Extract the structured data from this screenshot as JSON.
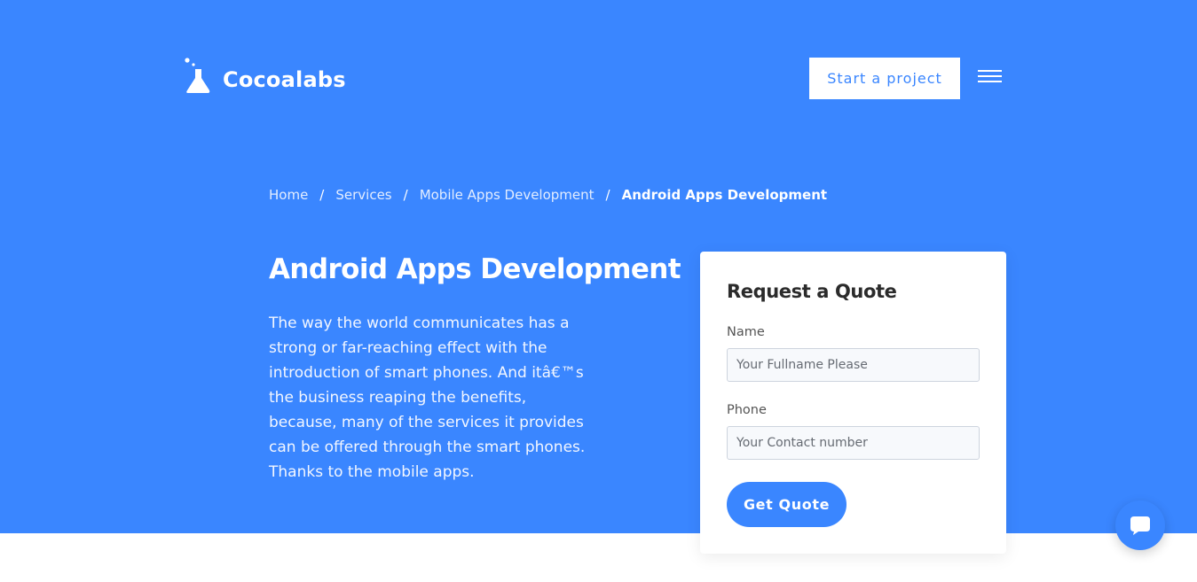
{
  "colors": {
    "brand": "#3a86ff",
    "card": "#ffffff",
    "title_dark": "#2b2b2b"
  },
  "header": {
    "logo_icon": "flask-icon",
    "logo_text": "Cocoalabs",
    "cta_label": "Start a project",
    "menu_icon": "hamburger-icon"
  },
  "breadcrumb": {
    "items": [
      "Home",
      "Services",
      "Mobile Apps Development"
    ],
    "separator": "/",
    "current": "Android Apps Development"
  },
  "hero": {
    "title": "Android Apps Development",
    "intro": "The way the world communicates has a strong or far-reaching effect with the introduction of smart phones. And itâ€™s the business reaping the benefits, because, many of the services it provides can be offered through the smart phones. Thanks to the mobile apps."
  },
  "quote_form": {
    "title": "Request a Quote",
    "name_label": "Name",
    "name_placeholder": "Your Fullname Please",
    "phone_label": "Phone",
    "phone_placeholder": "Your Contact number",
    "submit_label": "Get Quote"
  },
  "chat": {
    "icon": "chat-bubble-icon"
  }
}
